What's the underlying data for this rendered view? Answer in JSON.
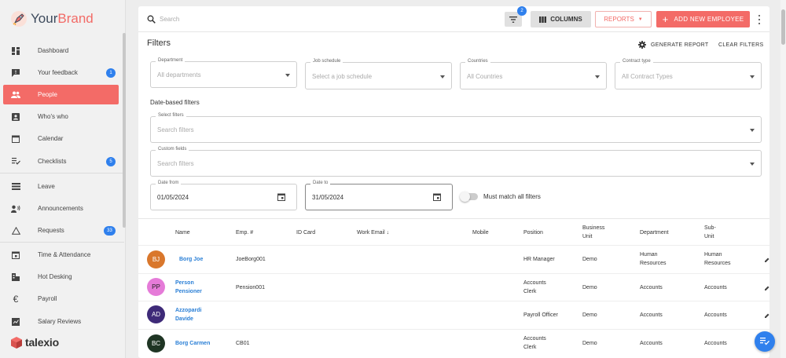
{
  "brand": {
    "name_prefix": "Your",
    "name_suffix": "Brand",
    "footer_logo": "talexio"
  },
  "sidebar": {
    "items": [
      {
        "label": "Dashboard",
        "icon": "dashboard-icon"
      },
      {
        "label": "Your feedback",
        "icon": "feedback-icon",
        "badge": "1"
      },
      {
        "label": "People",
        "icon": "people-icon",
        "active": true
      },
      {
        "label": "Who's who",
        "icon": "contact-card-icon"
      },
      {
        "label": "Calendar",
        "icon": "calendar-icon"
      },
      {
        "label": "Checklists",
        "icon": "checklist-icon",
        "badge": "5"
      },
      {
        "label": "Leave",
        "icon": "leave-icon"
      },
      {
        "label": "Announcements",
        "icon": "announcements-icon"
      },
      {
        "label": "Requests",
        "icon": "requests-icon",
        "badge": "33"
      },
      {
        "label": "Time & Attendance",
        "icon": "time-attendance-icon"
      },
      {
        "label": "Hot Desking",
        "icon": "hot-desking-icon"
      },
      {
        "label": "Payroll",
        "icon": "euro-icon"
      },
      {
        "label": "Salary Reviews",
        "icon": "salary-reviews-icon"
      }
    ]
  },
  "topbar": {
    "search_placeholder": "Search",
    "filter_badge": "2",
    "columns_label": "COLUMNS",
    "reports_label": "REPORTS",
    "add_label": "ADD NEW EMPLOYEE"
  },
  "filters": {
    "title": "Filters",
    "generate_report": "GENERATE REPORT",
    "clear_filters": "CLEAR FILTERS",
    "department": {
      "label": "Department",
      "value": "All departments"
    },
    "job_schedule": {
      "label": "Job schedule",
      "value": "Select a job schedule"
    },
    "countries": {
      "label": "Countries",
      "value": "All Countries"
    },
    "contract_type": {
      "label": "Contract type",
      "value": "All Contract Types"
    },
    "date_section": "Date-based filters",
    "select_filters": {
      "label": "Select filters",
      "value": "Search filters"
    },
    "custom_fields": {
      "label": "Custom fields",
      "value": "Search filters"
    },
    "date_from": {
      "label": "Date from",
      "value": "01/05/2024"
    },
    "date_to": {
      "label": "Date to",
      "value": "31/05/2024"
    },
    "match_all": {
      "label": "Must match all filters",
      "enabled": false
    }
  },
  "table": {
    "headers": {
      "name": "Name",
      "emp_no": "Emp. #",
      "id_card": "ID Card",
      "work_email": "Work Email",
      "mobile": "Mobile",
      "position": "Position",
      "business_unit_1": "Business",
      "business_unit_2": "Unit",
      "department": "Department",
      "sub_unit_1": "Sub-",
      "sub_unit_2": "Unit"
    },
    "rows": [
      {
        "initials": "BJ",
        "avatar_color": "#d9772c",
        "name_1": "Borg Joe",
        "name_2": "",
        "emp": "JoeBorg001",
        "position_1": "HR Manager",
        "position_2": "",
        "bu": "Demo",
        "dept_1": "Human",
        "dept_2": "Resources",
        "sub_1": "Human",
        "sub_2": "Resources"
      },
      {
        "initials": "PP",
        "avatar_color": "#e57bd8",
        "name_1": "Person",
        "name_2": "Pensioner",
        "emp": "Pension001",
        "position_1": "Accounts",
        "position_2": "Clerk",
        "bu": "Demo",
        "dept_1": "Accounts",
        "dept_2": "",
        "sub_1": "Accounts",
        "sub_2": ""
      },
      {
        "initials": "AD",
        "avatar_color": "#3e2a78",
        "name_1": "Azzopardi",
        "name_2": "Davide",
        "emp": "",
        "position_1": "Payroll Officer",
        "position_2": "",
        "bu": "Demo",
        "dept_1": "Accounts",
        "dept_2": "",
        "sub_1": "Accounts",
        "sub_2": ""
      },
      {
        "initials": "BC",
        "avatar_color": "#1f3524",
        "name_1": "Borg Carmen",
        "name_2": "",
        "emp": "CB01",
        "position_1": "Accounts",
        "position_2": "Clerk",
        "bu": "Demo",
        "dept_1": "Accounts",
        "dept_2": "",
        "sub_1": "Accounts",
        "sub_2": ""
      }
    ]
  },
  "colors": {
    "accent": "#f36b67",
    "link": "#2a7fd6",
    "badge": "#2f80ed"
  }
}
